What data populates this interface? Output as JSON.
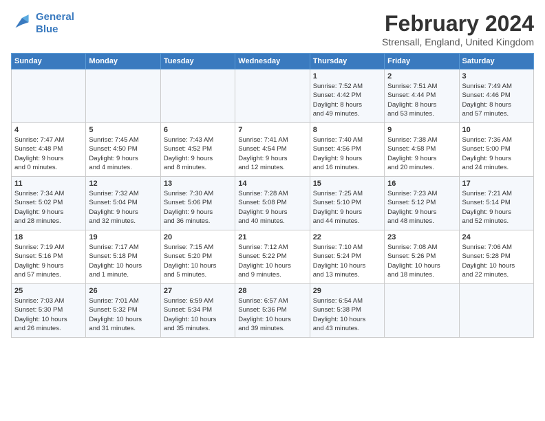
{
  "logo": {
    "line1": "General",
    "line2": "Blue"
  },
  "title": "February 2024",
  "subtitle": "Strensall, England, United Kingdom",
  "days_of_week": [
    "Sunday",
    "Monday",
    "Tuesday",
    "Wednesday",
    "Thursday",
    "Friday",
    "Saturday"
  ],
  "weeks": [
    {
      "cells": [
        {
          "day": "",
          "content": ""
        },
        {
          "day": "",
          "content": ""
        },
        {
          "day": "",
          "content": ""
        },
        {
          "day": "",
          "content": ""
        },
        {
          "day": "1",
          "content": "Sunrise: 7:52 AM\nSunset: 4:42 PM\nDaylight: 8 hours\nand 49 minutes."
        },
        {
          "day": "2",
          "content": "Sunrise: 7:51 AM\nSunset: 4:44 PM\nDaylight: 8 hours\nand 53 minutes."
        },
        {
          "day": "3",
          "content": "Sunrise: 7:49 AM\nSunset: 4:46 PM\nDaylight: 8 hours\nand 57 minutes."
        }
      ]
    },
    {
      "cells": [
        {
          "day": "4",
          "content": "Sunrise: 7:47 AM\nSunset: 4:48 PM\nDaylight: 9 hours\nand 0 minutes."
        },
        {
          "day": "5",
          "content": "Sunrise: 7:45 AM\nSunset: 4:50 PM\nDaylight: 9 hours\nand 4 minutes."
        },
        {
          "day": "6",
          "content": "Sunrise: 7:43 AM\nSunset: 4:52 PM\nDaylight: 9 hours\nand 8 minutes."
        },
        {
          "day": "7",
          "content": "Sunrise: 7:41 AM\nSunset: 4:54 PM\nDaylight: 9 hours\nand 12 minutes."
        },
        {
          "day": "8",
          "content": "Sunrise: 7:40 AM\nSunset: 4:56 PM\nDaylight: 9 hours\nand 16 minutes."
        },
        {
          "day": "9",
          "content": "Sunrise: 7:38 AM\nSunset: 4:58 PM\nDaylight: 9 hours\nand 20 minutes."
        },
        {
          "day": "10",
          "content": "Sunrise: 7:36 AM\nSunset: 5:00 PM\nDaylight: 9 hours\nand 24 minutes."
        }
      ]
    },
    {
      "cells": [
        {
          "day": "11",
          "content": "Sunrise: 7:34 AM\nSunset: 5:02 PM\nDaylight: 9 hours\nand 28 minutes."
        },
        {
          "day": "12",
          "content": "Sunrise: 7:32 AM\nSunset: 5:04 PM\nDaylight: 9 hours\nand 32 minutes."
        },
        {
          "day": "13",
          "content": "Sunrise: 7:30 AM\nSunset: 5:06 PM\nDaylight: 9 hours\nand 36 minutes."
        },
        {
          "day": "14",
          "content": "Sunrise: 7:28 AM\nSunset: 5:08 PM\nDaylight: 9 hours\nand 40 minutes."
        },
        {
          "day": "15",
          "content": "Sunrise: 7:25 AM\nSunset: 5:10 PM\nDaylight: 9 hours\nand 44 minutes."
        },
        {
          "day": "16",
          "content": "Sunrise: 7:23 AM\nSunset: 5:12 PM\nDaylight: 9 hours\nand 48 minutes."
        },
        {
          "day": "17",
          "content": "Sunrise: 7:21 AM\nSunset: 5:14 PM\nDaylight: 9 hours\nand 52 minutes."
        }
      ]
    },
    {
      "cells": [
        {
          "day": "18",
          "content": "Sunrise: 7:19 AM\nSunset: 5:16 PM\nDaylight: 9 hours\nand 57 minutes."
        },
        {
          "day": "19",
          "content": "Sunrise: 7:17 AM\nSunset: 5:18 PM\nDaylight: 10 hours\nand 1 minute."
        },
        {
          "day": "20",
          "content": "Sunrise: 7:15 AM\nSunset: 5:20 PM\nDaylight: 10 hours\nand 5 minutes."
        },
        {
          "day": "21",
          "content": "Sunrise: 7:12 AM\nSunset: 5:22 PM\nDaylight: 10 hours\nand 9 minutes."
        },
        {
          "day": "22",
          "content": "Sunrise: 7:10 AM\nSunset: 5:24 PM\nDaylight: 10 hours\nand 13 minutes."
        },
        {
          "day": "23",
          "content": "Sunrise: 7:08 AM\nSunset: 5:26 PM\nDaylight: 10 hours\nand 18 minutes."
        },
        {
          "day": "24",
          "content": "Sunrise: 7:06 AM\nSunset: 5:28 PM\nDaylight: 10 hours\nand 22 minutes."
        }
      ]
    },
    {
      "cells": [
        {
          "day": "25",
          "content": "Sunrise: 7:03 AM\nSunset: 5:30 PM\nDaylight: 10 hours\nand 26 minutes."
        },
        {
          "day": "26",
          "content": "Sunrise: 7:01 AM\nSunset: 5:32 PM\nDaylight: 10 hours\nand 31 minutes."
        },
        {
          "day": "27",
          "content": "Sunrise: 6:59 AM\nSunset: 5:34 PM\nDaylight: 10 hours\nand 35 minutes."
        },
        {
          "day": "28",
          "content": "Sunrise: 6:57 AM\nSunset: 5:36 PM\nDaylight: 10 hours\nand 39 minutes."
        },
        {
          "day": "29",
          "content": "Sunrise: 6:54 AM\nSunset: 5:38 PM\nDaylight: 10 hours\nand 43 minutes."
        },
        {
          "day": "",
          "content": ""
        },
        {
          "day": "",
          "content": ""
        }
      ]
    }
  ]
}
